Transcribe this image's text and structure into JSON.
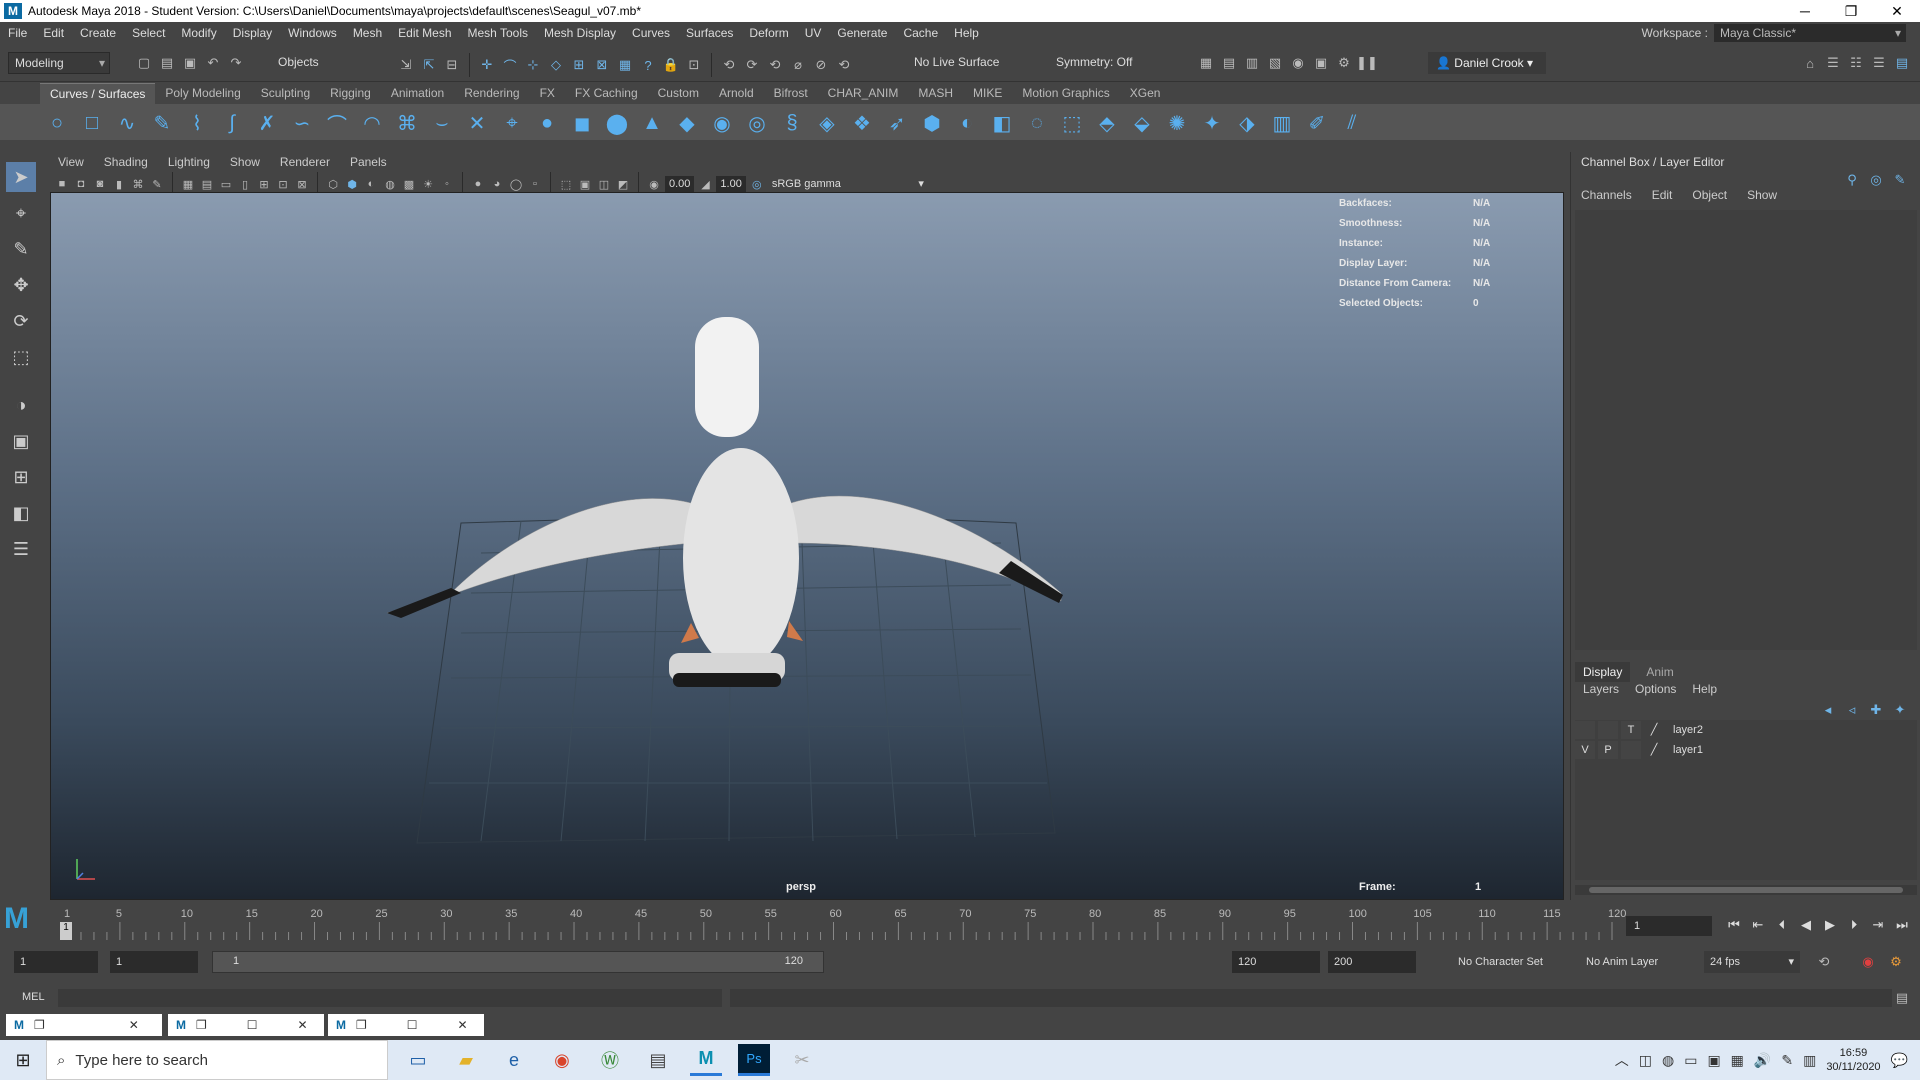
{
  "window": {
    "title": "Autodesk Maya 2018 - Student Version: C:\\Users\\Daniel\\Documents\\maya\\projects\\default\\scenes\\Seagul_v07.mb*",
    "logo": "M"
  },
  "menu": {
    "items": [
      "File",
      "Edit",
      "Create",
      "Select",
      "Modify",
      "Display",
      "Windows",
      "Mesh",
      "Edit Mesh",
      "Mesh Tools",
      "Mesh Display",
      "Curves",
      "Surfaces",
      "Deform",
      "UV",
      "Generate",
      "Cache",
      "Help"
    ],
    "workspace_label": "Workspace :",
    "workspace_value": "Maya Classic*"
  },
  "status": {
    "menuset": "Modeling",
    "selection_mode": "Objects",
    "live_surface": "No Live Surface",
    "symmetry": "Symmetry: Off",
    "user": "Daniel Crook"
  },
  "shelf": {
    "tabs": [
      "Curves / Surfaces",
      "Poly Modeling",
      "Sculpting",
      "Rigging",
      "Animation",
      "Rendering",
      "FX",
      "FX Caching",
      "Custom",
      "Arnold",
      "Bifrost",
      "CHAR_ANIM",
      "MASH",
      "MIKE",
      "Motion Graphics",
      "XGen"
    ],
    "active_tab": "Curves / Surfaces"
  },
  "panel": {
    "menus": [
      "View",
      "Shading",
      "Lighting",
      "Show",
      "Renderer",
      "Panels"
    ],
    "exposure": "0.00",
    "gamma": "1.00",
    "color_space": "sRGB gamma"
  },
  "hud": [
    {
      "label": "Backfaces:",
      "value": "N/A"
    },
    {
      "label": "Smoothness:",
      "value": "N/A"
    },
    {
      "label": "Instance:",
      "value": "N/A"
    },
    {
      "label": "Display Layer:",
      "value": "N/A"
    },
    {
      "label": "Distance From Camera:",
      "value": "N/A"
    },
    {
      "label": "Selected Objects:",
      "value": "0"
    }
  ],
  "viewport": {
    "camera": "persp",
    "frame_label": "Frame:",
    "frame_value": "1"
  },
  "channel_box": {
    "title": "Channel Box / Layer Editor",
    "menus": [
      "Channels",
      "Edit",
      "Object",
      "Show"
    ],
    "layer_tabs": [
      "Display",
      "Anim"
    ],
    "layer_menus": [
      "Layers",
      "Options",
      "Help"
    ],
    "layers": [
      {
        "v": "",
        "p": "",
        "t": "T",
        "name": "layer2"
      },
      {
        "v": "V",
        "p": "P",
        "t": "",
        "name": "layer1"
      }
    ]
  },
  "timeline": {
    "ticks": [
      "1",
      "5",
      "10",
      "15",
      "20",
      "25",
      "30",
      "35",
      "40",
      "45",
      "50",
      "55",
      "60",
      "65",
      "70",
      "75",
      "80",
      "85",
      "90",
      "95",
      "100",
      "105",
      "110",
      "115",
      "120"
    ],
    "current_frame": "1"
  },
  "range": {
    "start": "1",
    "playback_start": "1",
    "slider_low": "1",
    "slider_high": "120",
    "playback_end": "120",
    "end": "200",
    "character_set": "No Character Set",
    "anim_layer": "No Anim Layer",
    "fps": "24 fps"
  },
  "cmdline": {
    "language": "MEL"
  },
  "taskbar": {
    "search_placeholder": "Type here to search",
    "time": "16:59",
    "date": "30/11/2020"
  }
}
